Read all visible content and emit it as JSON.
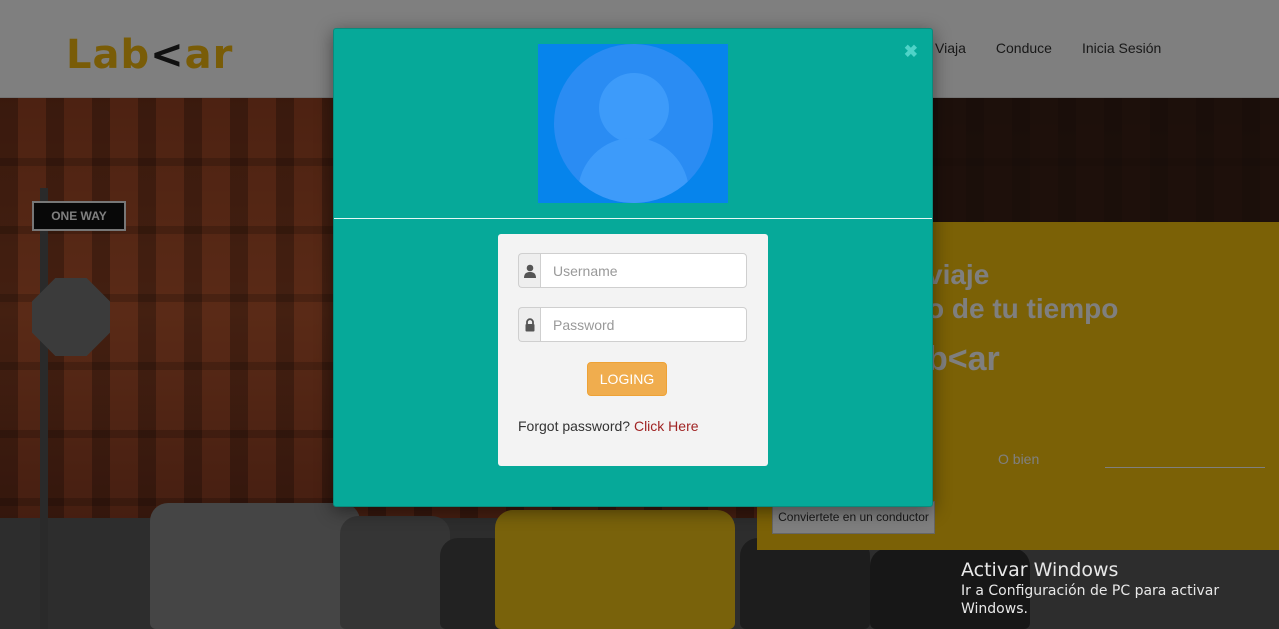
{
  "navbar": {
    "logo_left": "Lab",
    "logo_chevron": "<",
    "logo_right": "ar",
    "links": [
      "Viaja",
      "Conduce",
      "Inicia Sesión"
    ]
  },
  "hero": {
    "sign_text": "ONE WAY",
    "promo": {
      "title_line1": "viaje",
      "title_line2": "o de tu tiempo",
      "logo_partial": "b<ar",
      "or_text": "O bien",
      "driver_button": "Conviertete en un conductor"
    }
  },
  "modal": {
    "close_icon": "close-icon",
    "avatar_icon": "user-avatar-icon",
    "username_placeholder": "Username",
    "password_placeholder": "Password",
    "login_label": "LOGING",
    "forgot_text": "Forgot password?",
    "forgot_link": "Click Here"
  },
  "watermark": {
    "title": "Activar Windows",
    "subtitle": "Ir a Configuración de PC para activar Windows."
  },
  "colors": {
    "modal_bg": "#06a999",
    "brand_yellow": "#f2b90f",
    "login_button": "#f0ad4e",
    "link_red": "#a02424",
    "avatar_bg": "#0684ec"
  }
}
